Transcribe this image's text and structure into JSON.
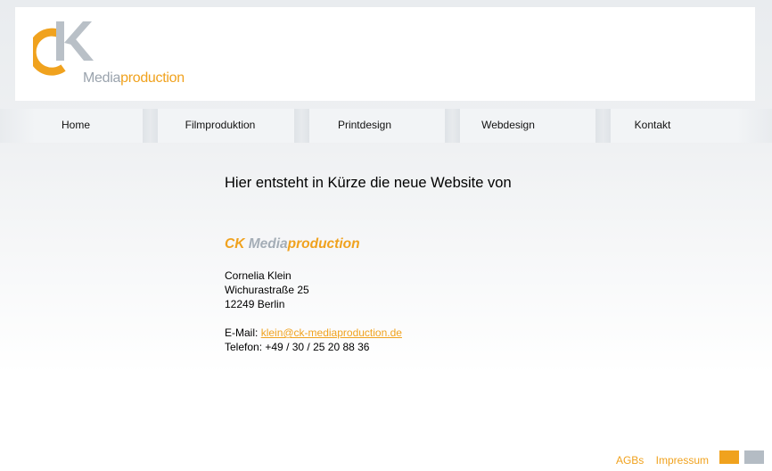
{
  "logo": {
    "monogram": "CK",
    "text_media": "Media",
    "text_production": "production"
  },
  "nav": {
    "items": [
      {
        "label": "Home"
      },
      {
        "label": "Filmproduktion"
      },
      {
        "label": "Printdesign"
      },
      {
        "label": "Webdesign"
      },
      {
        "label": "Kontakt"
      }
    ]
  },
  "main": {
    "headline": "Hier entsteht in Kürze die neue Website von",
    "brand": {
      "ck": "CK",
      "media": "Media",
      "production": "production"
    },
    "address": {
      "name": "Cornelia Klein",
      "street": "Wichurastraße 25",
      "city": "12249 Berlin"
    },
    "contact": {
      "email_label": "E-Mail:",
      "email": "klein@ck-mediaproduction.de",
      "phone_label": "Telefon:",
      "phone": "+49 / 30 / 25 20 88 36"
    }
  },
  "footer": {
    "agb": "AGBs",
    "impressum": "Impressum"
  },
  "colors": {
    "accent_orange": "#f0a21e",
    "accent_gray": "#a4adb6"
  }
}
